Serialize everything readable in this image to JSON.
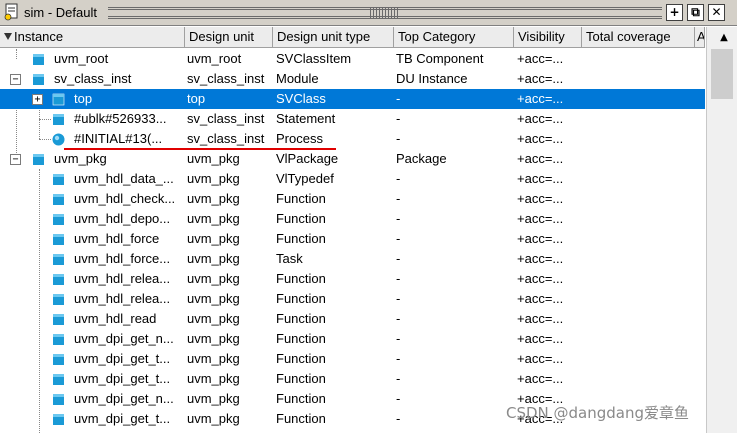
{
  "window": {
    "title": "sim - Default",
    "buttons": {
      "add": "+",
      "restore": "⧉",
      "close": "✕"
    }
  },
  "columns": [
    "Instance",
    "Design unit",
    "Design unit type",
    "Top Category",
    "Visibility",
    "Total coverage",
    "A"
  ],
  "rows": [
    {
      "instance": "uvm_root",
      "unit": "uvm_root",
      "type": "SVClassItem",
      "category": "TB Component",
      "visibility": "+acc=..."
    },
    {
      "instance": "sv_class_inst",
      "unit": "sv_class_inst",
      "type": "Module",
      "category": "DU Instance",
      "visibility": "+acc=..."
    },
    {
      "instance": "top",
      "unit": "top",
      "type": "SVClass",
      "category": "-",
      "visibility": "+acc=..."
    },
    {
      "instance": "#ublk#526933...",
      "unit": "sv_class_inst",
      "type": "Statement",
      "category": "-",
      "visibility": "+acc=..."
    },
    {
      "instance": "#INITIAL#13(...",
      "unit": "sv_class_inst",
      "type": "Process",
      "category": "-",
      "visibility": "+acc=..."
    },
    {
      "instance": "uvm_pkg",
      "unit": "uvm_pkg",
      "type": "VlPackage",
      "category": "Package",
      "visibility": "+acc=..."
    },
    {
      "instance": "uvm_hdl_data_...",
      "unit": "uvm_pkg",
      "type": "VlTypedef",
      "category": "-",
      "visibility": "+acc=..."
    },
    {
      "instance": "uvm_hdl_check...",
      "unit": "uvm_pkg",
      "type": "Function",
      "category": "-",
      "visibility": "+acc=..."
    },
    {
      "instance": "uvm_hdl_depo...",
      "unit": "uvm_pkg",
      "type": "Function",
      "category": "-",
      "visibility": "+acc=..."
    },
    {
      "instance": "uvm_hdl_force",
      "unit": "uvm_pkg",
      "type": "Function",
      "category": "-",
      "visibility": "+acc=..."
    },
    {
      "instance": "uvm_hdl_force...",
      "unit": "uvm_pkg",
      "type": "Task",
      "category": "-",
      "visibility": "+acc=..."
    },
    {
      "instance": "uvm_hdl_relea...",
      "unit": "uvm_pkg",
      "type": "Function",
      "category": "-",
      "visibility": "+acc=..."
    },
    {
      "instance": "uvm_hdl_relea...",
      "unit": "uvm_pkg",
      "type": "Function",
      "category": "-",
      "visibility": "+acc=..."
    },
    {
      "instance": "uvm_hdl_read",
      "unit": "uvm_pkg",
      "type": "Function",
      "category": "-",
      "visibility": "+acc=..."
    },
    {
      "instance": "uvm_dpi_get_n...",
      "unit": "uvm_pkg",
      "type": "Function",
      "category": "-",
      "visibility": "+acc=..."
    },
    {
      "instance": "uvm_dpi_get_t...",
      "unit": "uvm_pkg",
      "type": "Function",
      "category": "-",
      "visibility": "+acc=..."
    },
    {
      "instance": "uvm_dpi_get_t...",
      "unit": "uvm_pkg",
      "type": "Function",
      "category": "-",
      "visibility": "+acc=..."
    },
    {
      "instance": "uvm_dpi_get_n...",
      "unit": "uvm_pkg",
      "type": "Function",
      "category": "-",
      "visibility": "+acc=..."
    },
    {
      "instance": "uvm_dpi_get_t...",
      "unit": "uvm_pkg",
      "type": "Function",
      "category": "-",
      "visibility": "+acc=..."
    }
  ],
  "scrollbar": {
    "up_arrow": "▲"
  },
  "watermark": "CSDN @dangdang爱章鱼",
  "colors": {
    "selection": "#0078d7",
    "annotation_underline": "#e00000",
    "node_icon": "#1a9ad6"
  }
}
